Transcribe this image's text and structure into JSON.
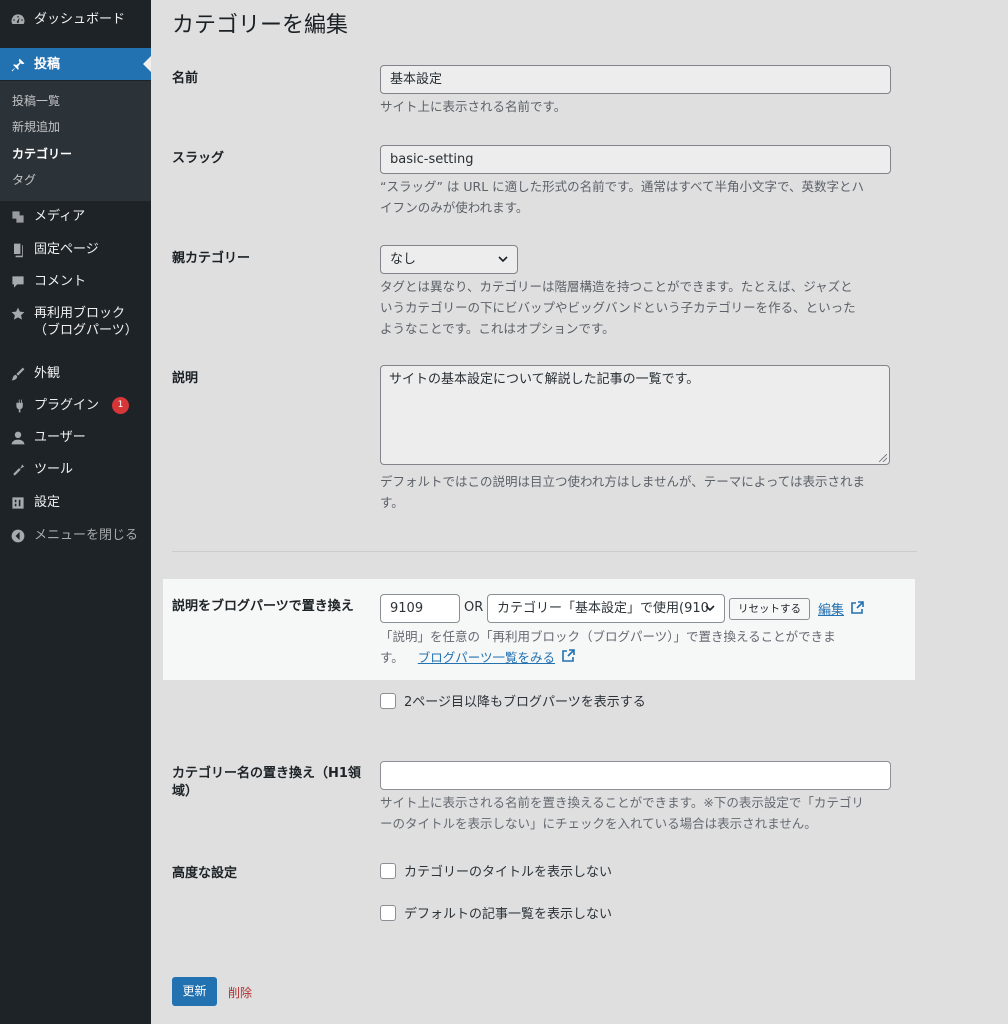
{
  "sidebar": {
    "dashboard": "ダッシュボード",
    "posts": "投稿",
    "submenu": [
      "投稿一覧",
      "新規追加",
      "カテゴリー",
      "タグ"
    ],
    "media": "メディア",
    "pages": "固定ページ",
    "comments": "コメント",
    "reusable_line1": "再利用ブロック",
    "reusable_line2": "（ブログパーツ）",
    "appearance": "外観",
    "plugins": "プラグイン",
    "plugins_badge": "1",
    "users": "ユーザー",
    "tools": "ツール",
    "settings": "設定",
    "collapse": "メニューを閉じる"
  },
  "main": {
    "title": "カテゴリーを編集",
    "name_label": "名前",
    "name_value": "基本設定",
    "name_desc": "サイト上に表示される名前です。",
    "slug_label": "スラッグ",
    "slug_value": "basic-setting",
    "slug_desc_1": "“スラッグ” は URL に適した形式の名前です。通常はすべて半角小文字で、英数字とハ",
    "slug_desc_2": "イフンのみが使われます。",
    "parent_label": "親カテゴリー",
    "parent_value": "なし",
    "parent_desc_1": "タグとは異なり、カテゴリーは階層構造を持つことができます。たとえば、ジャズと",
    "parent_desc_2": "いうカテゴリーの下にビバップやビッグバンドという子カテゴリーを作る、といった",
    "parent_desc_3": "ようなことです。これはオプションです。",
    "description_label": "説明",
    "description_value": "サイトの基本設定について解説した記事の一覧です。",
    "description_desc_1": "デフォルトではこの説明は目立つ使われ方はしませんが、テーマによっては表示されま",
    "description_desc_2": "す。",
    "blockparts_label": "説明をブログパーツで置き換え",
    "blockparts_id": "9109",
    "blockparts_or": "OR",
    "blockparts_select": "カテゴリー「基本設定」で使用(910",
    "reset_button": "リセットする",
    "edit_link": "編集",
    "blockparts_desc_1": "「説明」を任意の「再利用ブロック（ブログパーツ）」で置き換えることができま",
    "blockparts_desc_2": "す。",
    "blockparts_list_link": "ブログパーツ一覧をみる",
    "page2_checkbox": "2ページ目以降もブログパーツを表示する",
    "h1_label_1": "カテゴリー名の置き換え（H1領",
    "h1_label_2": "域）",
    "h1_value": "",
    "h1_desc_1": "サイト上に表示される名前を置き換えることができます。※下の表示設定で「カテゴリ",
    "h1_desc_2": "ーのタイトルを表示しない」にチェックを入れている場合は表示されません。",
    "advanced_label": "高度な設定",
    "hide_title_checkbox": "カテゴリーのタイトルを表示しない",
    "hide_list_checkbox": "デフォルトの記事一覧を表示しない",
    "update_button": "更新",
    "delete_link": "削除"
  },
  "colors": {
    "sidebar_bg": "#1d2327",
    "accent": "#2271b1",
    "badge": "#d63638",
    "delete": "#b32d2e"
  }
}
